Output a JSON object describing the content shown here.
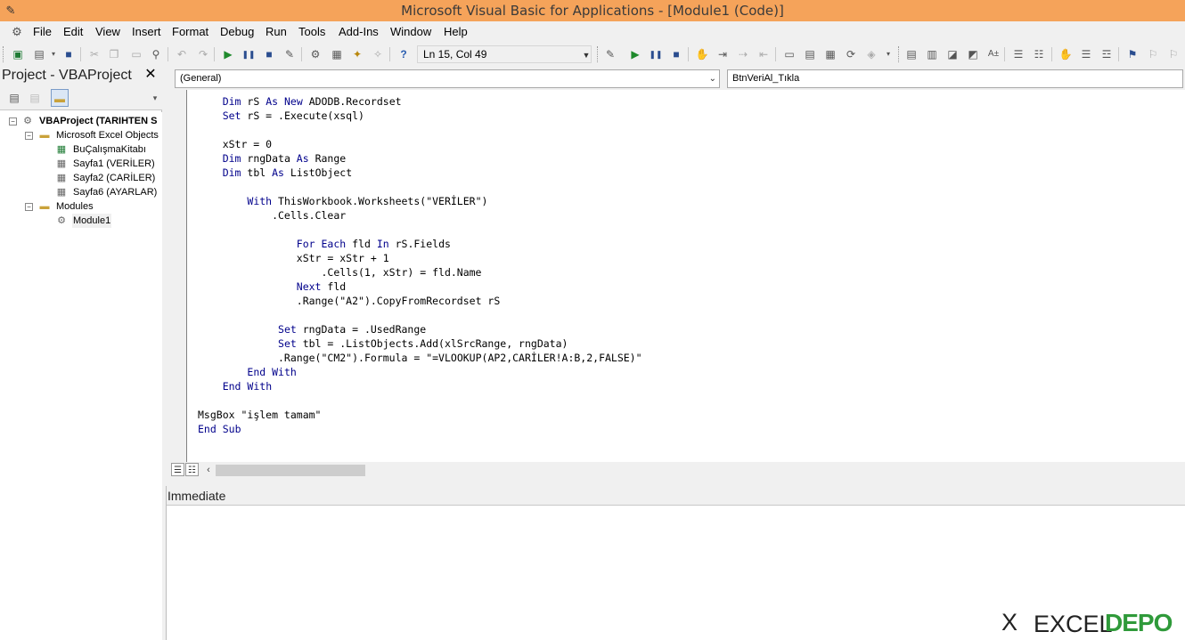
{
  "window": {
    "title": "Microsoft Visual Basic for Applications - [Module1 (Code)]",
    "icon": "vba-app-icon"
  },
  "menu": {
    "icon": "module-icon",
    "items": [
      "File",
      "Edit",
      "View",
      "Insert",
      "Format",
      "Debug",
      "Run",
      "Tools",
      "Add-Ins",
      "Window",
      "Help"
    ]
  },
  "toolbar": {
    "cursor_position": "Ln 15, Col 49"
  },
  "project": {
    "title": "Project - VBAProject",
    "close_glyph": "✕",
    "tree": [
      {
        "label": "VBAProject (TARIHTEN S",
        "icon": "vba-project-icon",
        "bold": true
      },
      {
        "label": "Microsoft Excel Objects",
        "icon": "folder-icon"
      },
      {
        "label": "BuÇalışmaKitabı",
        "icon": "workbook-icon"
      },
      {
        "label": "Sayfa1 (VERİLER)",
        "icon": "worksheet-icon"
      },
      {
        "label": "Sayfa2 (CARİLER)",
        "icon": "worksheet-icon"
      },
      {
        "label": "Sayfa6 (AYARLAR)",
        "icon": "worksheet-icon"
      },
      {
        "label": "Modules",
        "icon": "folder-icon"
      },
      {
        "label": "Module1",
        "icon": "module-icon",
        "selected": true
      }
    ]
  },
  "code": {
    "object_combo": "(General)",
    "procedure_combo": "BtnVeriAl_Tıkla",
    "lines": [
      "    Dim rS As New ADODB.Recordset",
      "    Set rS = .Execute(xsql)",
      "",
      "    xStr = 0",
      "    Dim rngData As Range",
      "    Dim tbl As ListObject",
      "",
      "        With ThisWorkbook.Worksheets(\"VERİLER\")",
      "            .Cells.Clear",
      "",
      "                For Each fld In rS.Fields",
      "                xStr = xStr + 1",
      "                    .Cells(1, xStr) = fld.Name",
      "                Next fld",
      "                .Range(\"A2\").CopyFromRecordset rS",
      "",
      "             Set rngData = .UsedRange",
      "             Set tbl = .ListObjects.Add(xlSrcRange, rngData)",
      "             .Range(\"CM2\").Formula = \"=VLOOKUP(AP2,CARİLER!A:B,2,FALSE)\"",
      "        End With",
      "    End With",
      "",
      "MsgBox \"işlem tamam\"",
      "End Sub"
    ]
  },
  "immediate": {
    "title": "Immediate"
  },
  "watermark": {
    "x_glyph": "X",
    "excel": "EXCEL",
    "depo": "DEPO",
    "depo_color": "#2f9a3a"
  },
  "colors": {
    "titlebar": "#f5a35a",
    "keyword": "#00008b"
  }
}
